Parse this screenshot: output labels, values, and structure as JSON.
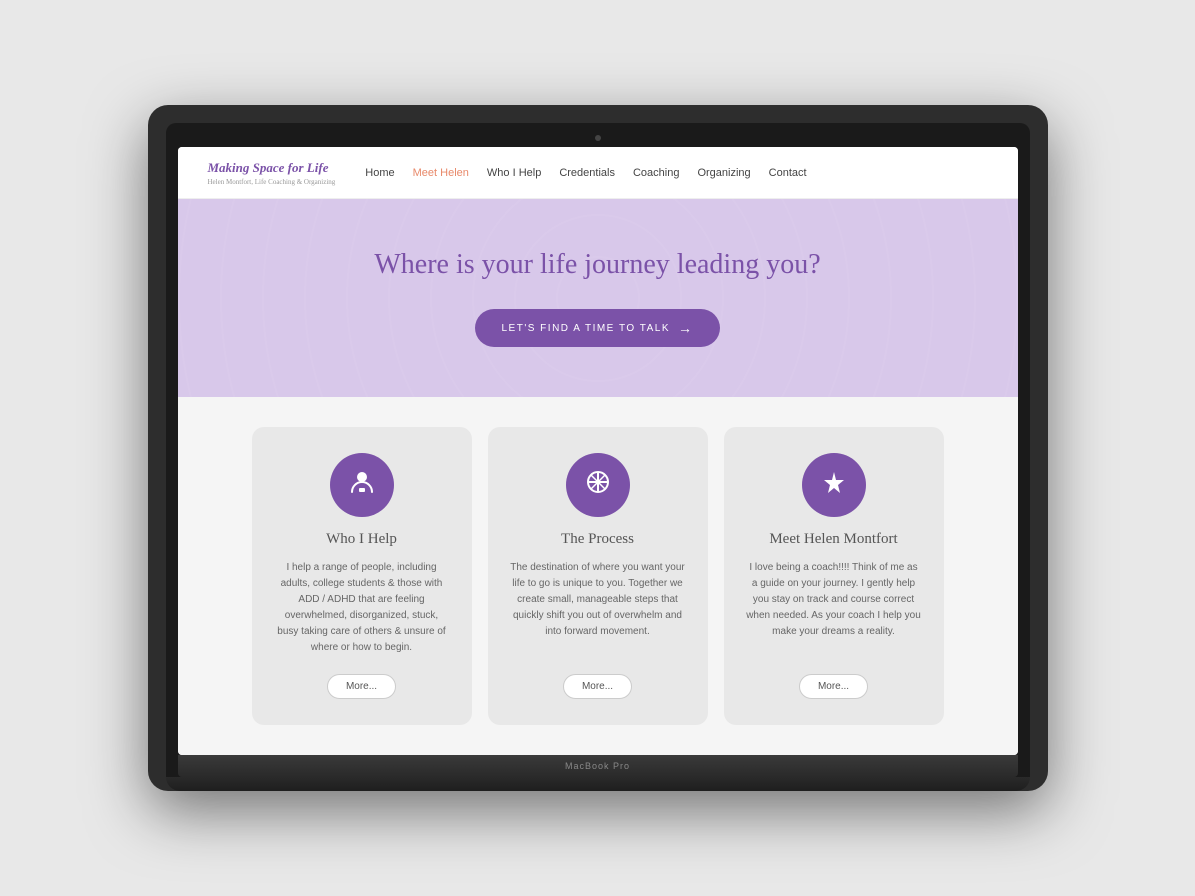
{
  "laptop": {
    "brand": "MacBook Pro"
  },
  "nav": {
    "logo_main": "Making Space for Life",
    "logo_sub": "Helen Montfort, Life Coaching & Organizing",
    "links": [
      {
        "label": "Home",
        "active": false
      },
      {
        "label": "Meet Helen",
        "active": true
      },
      {
        "label": "Who I Help",
        "active": false
      },
      {
        "label": "Credentials",
        "active": false
      },
      {
        "label": "Coaching",
        "active": false
      },
      {
        "label": "Organizing",
        "active": false
      },
      {
        "label": "Contact",
        "active": false
      }
    ]
  },
  "hero": {
    "title": "Where is your life journey leading you?",
    "button_label": "LET'S FIND A TIME TO TALK"
  },
  "cards": [
    {
      "icon": "👤",
      "title": "Who I Help",
      "text": "I help a range of people, including adults, college students & those with ADD / ADHD that are feeling overwhelmed, disorganized, stuck, busy taking care of others & unsure of where or how to begin.",
      "button": "More..."
    },
    {
      "icon": "✦",
      "title": "The Process",
      "text": "The destination of where you want your life to go is unique to you. Together we create small, manageable steps that quickly shift you out of overwhelm and into forward movement.",
      "button": "More..."
    },
    {
      "icon": "✦",
      "title": "Meet Helen Montfort",
      "text": "I love being a coach!!!! Think of me as a guide on your journey. I gently help you stay on track and course correct when needed. As your coach I help you make your dreams a reality.",
      "button": "More..."
    }
  ]
}
